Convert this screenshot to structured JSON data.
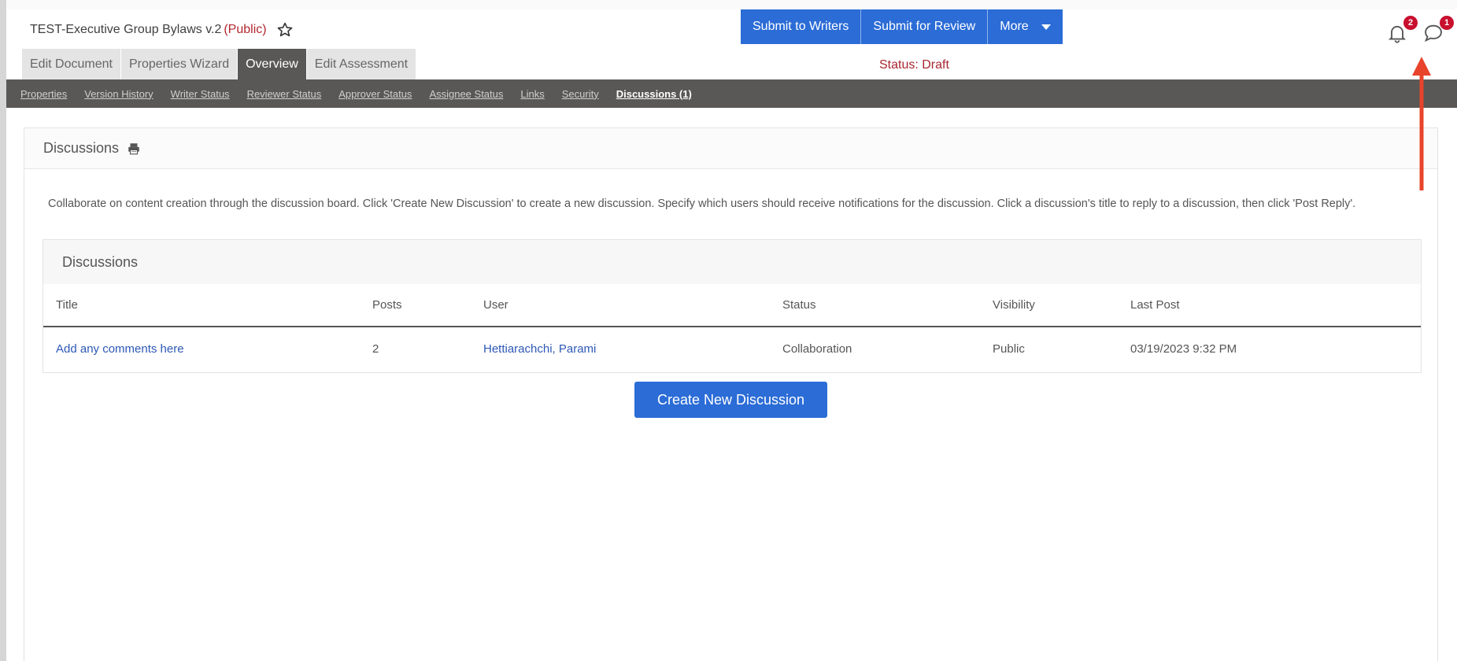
{
  "header": {
    "doc_title": "TEST-Executive Group Bylaws v.2",
    "visibility": "(Public)",
    "status": "Status: Draft",
    "actions": {
      "submit_writers": "Submit to Writers",
      "submit_review": "Submit for Review",
      "more": "More"
    },
    "notifications": {
      "bell_count": "2",
      "chat_count": "1"
    }
  },
  "tabs": [
    "Edit Document",
    "Properties Wizard",
    "Overview",
    "Edit Assessment"
  ],
  "subnav": [
    "Properties",
    "Version History",
    "Writer Status",
    "Reviewer Status",
    "Approver Status",
    "Assignee Status",
    "Links",
    "Security",
    "Discussions (1)"
  ],
  "panel": {
    "title": "Discussions",
    "intro": "Collaborate on content creation through the discussion board. Click 'Create New Discussion' to create a new discussion. Specify which users should receive notifications for the discussion. Click a discussion's title to reply to a discussion, then click 'Post Reply'.",
    "box_title": "Discussions",
    "columns": [
      "Title",
      "Posts",
      "User",
      "Status",
      "Visibility",
      "Last Post"
    ],
    "rows": [
      {
        "title": "Add any comments here",
        "posts": "2",
        "user": "Hettiarachchi, Parami",
        "status": "Collaboration",
        "visibility": "Public",
        "last_post": "03/19/2023 9:32 PM"
      }
    ],
    "create_button": "Create New Discussion"
  },
  "colors": {
    "accent": "#2b6cd6",
    "status_red": "#a8262f",
    "nav_dark": "#5a5757",
    "badge": "#c8102e",
    "arrow": "#e8432b"
  }
}
